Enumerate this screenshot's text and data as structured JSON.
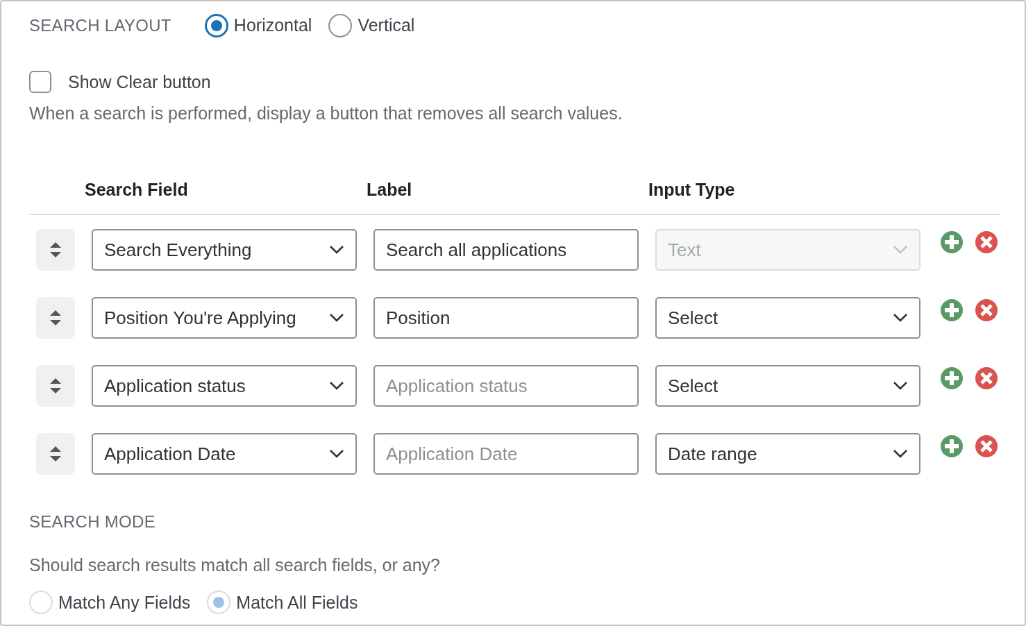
{
  "search_layout": {
    "title": "SEARCH LAYOUT",
    "options": [
      {
        "label": "Horizontal",
        "selected": true
      },
      {
        "label": "Vertical",
        "selected": false
      }
    ]
  },
  "show_clear": {
    "label": "Show Clear button",
    "checked": false,
    "description": "When a search is performed, display a button that removes all search values."
  },
  "table": {
    "columns": [
      "Search Field",
      "Label",
      "Input Type"
    ],
    "rows": [
      {
        "field": "Search Everything",
        "label": {
          "value": "Search all applications"
        },
        "input_type": {
          "value": "Text",
          "disabled": true
        }
      },
      {
        "field": "Position You're Applying",
        "label": {
          "value": "Position"
        },
        "input_type": {
          "value": "Select",
          "disabled": false
        }
      },
      {
        "field": "Application status",
        "label": {
          "placeholder": "Application status"
        },
        "input_type": {
          "value": "Select",
          "disabled": false
        }
      },
      {
        "field": "Application Date",
        "label": {
          "placeholder": "Application Date"
        },
        "input_type": {
          "value": "Date range",
          "disabled": false
        }
      }
    ]
  },
  "search_mode": {
    "title": "SEARCH MODE",
    "description": "Should search results match all search fields, or any?",
    "disabled": true,
    "options": [
      {
        "label": "Match Any Fields",
        "selected": false
      },
      {
        "label": "Match All Fields",
        "selected": true
      }
    ]
  }
}
